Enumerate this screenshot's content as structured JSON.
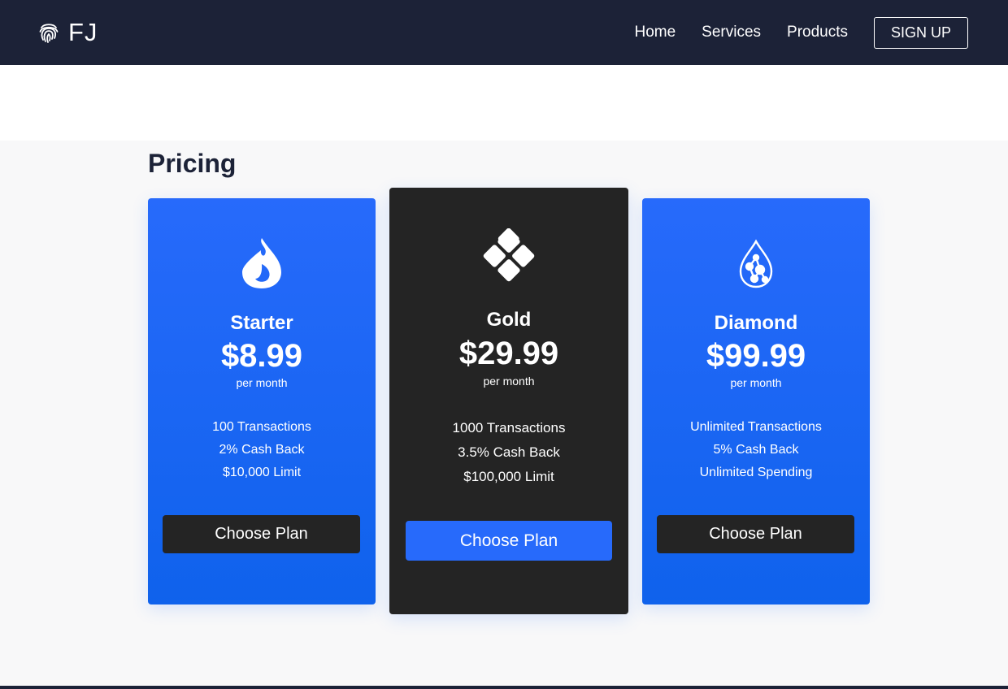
{
  "navbar": {
    "logo_text": "FJ",
    "logo_icon": "fingerprint-icon",
    "links": [
      "Home",
      "Services",
      "Products"
    ],
    "signup_label": "SIGN UP"
  },
  "pricing": {
    "title": "Pricing",
    "plans": [
      {
        "icon": "fire-icon",
        "name": "Starter",
        "price": "$8.99",
        "period": "per month",
        "features": [
          "100 Transactions",
          "2% Cash Back",
          "$10,000 Limit"
        ],
        "button": "Choose Plan"
      },
      {
        "icon": "diamond-grid-icon",
        "name": "Gold",
        "price": "$29.99",
        "period": "per month",
        "features": [
          "1000 Transactions",
          "3.5% Cash Back",
          "$100,000 Limit"
        ],
        "button": "Choose Plan"
      },
      {
        "icon": "gem-drop-icon",
        "name": "Diamond",
        "price": "$99.99",
        "period": "per month",
        "features": [
          "Unlimited Transactions",
          "5% Cash Back",
          "Unlimited Spending"
        ],
        "button": "Choose Plan"
      }
    ]
  },
  "colors": {
    "navbar_bg": "#1c2237",
    "card_blue": "#276afb",
    "card_dark": "#242424",
    "section_bg": "#f8f8f9"
  }
}
